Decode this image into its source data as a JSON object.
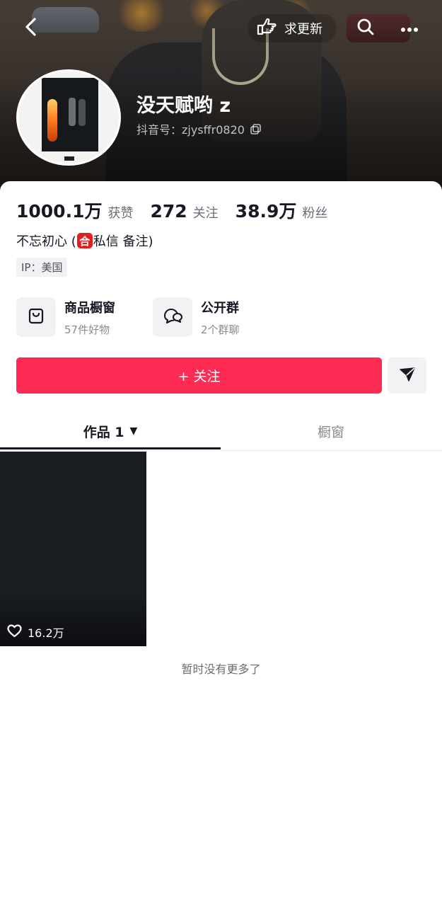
{
  "header": {
    "update_request_label": "求更新",
    "icons": [
      "back-arrow-icon",
      "pointing-hand-icon",
      "search-icon",
      "more-dots-icon"
    ]
  },
  "profile": {
    "nickname": "没天赋哟 z",
    "douyin_id": "抖音号：zjysffr0820",
    "avatar": "album-cover-avatar"
  },
  "stats": {
    "likes_value": "1000.1万",
    "likes_label": "获赞",
    "following_value": "272",
    "following_label": "关注",
    "followers_value": "38.9万",
    "followers_label": "粉丝"
  },
  "bio": {
    "text_before": "不忘初心 (",
    "badge": "合",
    "text_after": "私信 备注)"
  },
  "ip_tag": "IP：美国",
  "features": {
    "shop": {
      "title": "商品橱窗",
      "subtitle": "57件好物",
      "icon": "shopping-bag-icon"
    },
    "group": {
      "title": "公开群",
      "subtitle": "2个群聊",
      "icon": "group-chat-icon"
    }
  },
  "actions": {
    "follow_label": "+ 关注",
    "share_icon": "send-arrow-icon"
  },
  "tabs": {
    "works_label": "作品 1",
    "showcase_label": "橱窗",
    "active": "works"
  },
  "videos": [
    {
      "likes": "16.2万"
    }
  ],
  "footer_text": "暂时没有更多了",
  "colors": {
    "accent": "#fe2c55",
    "text_primary": "#161823",
    "text_secondary": "#8a8b91",
    "badge_red": "#e02020"
  }
}
